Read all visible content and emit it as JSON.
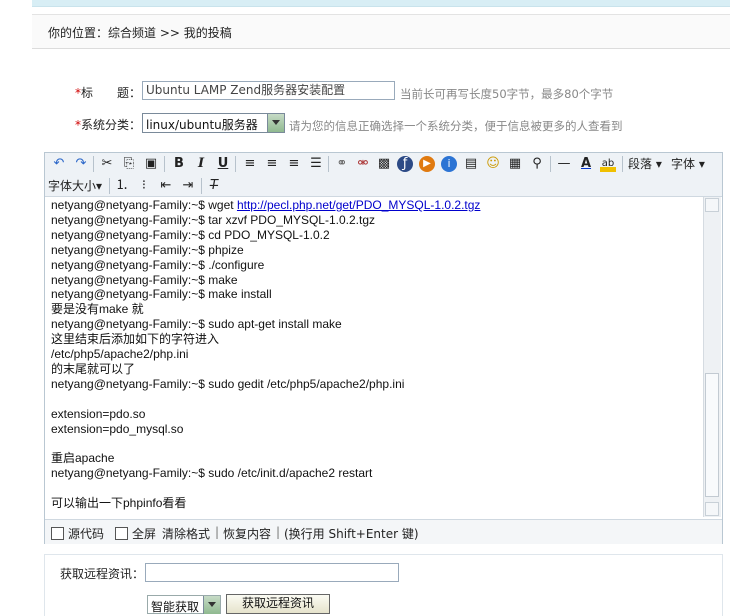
{
  "breadcrumb": {
    "text": "你的位置：综合频道 >> 我的投稿"
  },
  "form": {
    "title_label": "标　　题：",
    "title_value": "Ubuntu LAMP Zend服务器安装配置",
    "title_hint": "当前长可再写长度50字节，最多80个字节",
    "category_label": "系统分类：",
    "category_value": "linux/ubuntu服务器",
    "category_hint": "请为您的信息正确选择一个系统分类，便于信息被更多的人查看到",
    "required_mark": "*"
  },
  "toolbar": {
    "paragraph_label": "段落",
    "font_label": "字体",
    "font_size_label": "字体大小"
  },
  "content": {
    "lines": [
      {
        "text": "netyang@netyang-Family:~$ wget ",
        "link": "http://pecl.php.net/get/PDO_MYSQL-1.0.2.tgz"
      },
      {
        "text": "netyang@netyang-Family:~$ tar xzvf PDO_MYSQL-1.0.2.tgz"
      },
      {
        "text": "netyang@netyang-Family:~$ cd PDO_MYSQL-1.0.2"
      },
      {
        "text": "netyang@netyang-Family:~$ phpize"
      },
      {
        "text": "netyang@netyang-Family:~$ ./configure"
      },
      {
        "text": "netyang@netyang-Family:~$ make"
      },
      {
        "text": "netyang@netyang-Family:~$ make install"
      },
      {
        "text": "要是没有make 就"
      },
      {
        "text": "netyang@netyang-Family:~$ sudo apt-get install make"
      },
      {
        "text": "这里结束后添加如下的字符进入"
      },
      {
        "text": "/etc/php5/apache2/php.ini"
      },
      {
        "text": "的末尾就可以了"
      },
      {
        "text": "netyang@netyang-Family:~$ sudo gedit /etc/php5/apache2/php.ini"
      },
      {
        "text": ""
      },
      {
        "text": "extension=pdo.so"
      },
      {
        "text": "extension=pdo_mysql.so"
      },
      {
        "text": ""
      },
      {
        "text": "重启apache"
      },
      {
        "text": "netyang@netyang-Family:~$ sudo /etc/init.d/apache2 restart"
      },
      {
        "text": ""
      },
      {
        "text": "可以输出一下phpinfo看看"
      }
    ]
  },
  "statusbar": {
    "source_label": "源代码",
    "fullscreen_label": "全屏",
    "clear_format": "清除格式",
    "restore_content": "恢复内容",
    "newline_hint": "(换行用  Shift+Enter 键)",
    "divider": "|"
  },
  "remote": {
    "label": "获取远程资讯：",
    "input_value": "",
    "mode_value": "智能获取",
    "button_label": "获取远程资讯"
  },
  "colors": {
    "link": "#0000cc",
    "required": "#d00000",
    "hint": "#888888",
    "toolbar_bg": "#eef2f6"
  },
  "icons": [
    "undo-icon",
    "redo-icon",
    "cut-icon",
    "copy-icon",
    "paste-icon",
    "bold-icon",
    "italic-icon",
    "underline-icon",
    "align-left-icon",
    "align-center-icon",
    "align-right-icon",
    "justify-icon",
    "link-icon",
    "unlink-icon",
    "image-icon",
    "flash-icon",
    "media-icon",
    "info-icon",
    "table-icon",
    "emoticon-icon",
    "template-icon",
    "search-icon",
    "horizontal-rule-icon",
    "font-color-icon",
    "highlight-icon",
    "ordered-list-icon",
    "unordered-list-icon",
    "outdent-icon",
    "indent-icon",
    "remove-format-icon"
  ]
}
